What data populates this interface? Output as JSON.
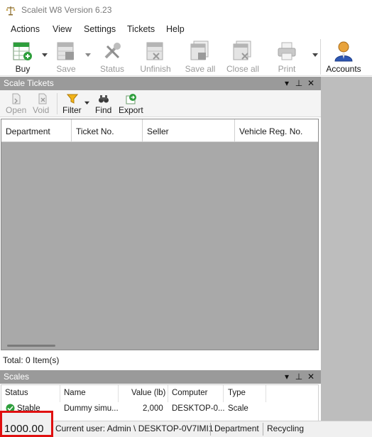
{
  "window": {
    "title": "Scaleit W8 Version 6.23"
  },
  "menu": [
    "Actions",
    "View",
    "Settings",
    "Tickets",
    "Help"
  ],
  "toolbar": {
    "buy": "Buy",
    "save": "Save",
    "status": "Status",
    "unfinish": "Unfinish",
    "save_all": "Save all",
    "close_all": "Close all",
    "print": "Print",
    "accounts": "Accounts"
  },
  "tickets_panel": {
    "title": "Scale Tickets",
    "buttons": {
      "open": "Open",
      "void": "Void",
      "filter": "Filter",
      "find": "Find",
      "export": "Export"
    },
    "columns": [
      "Department",
      "Ticket No.",
      "Seller",
      "Vehicle Reg. No."
    ],
    "total": "Total: 0 Item(s)"
  },
  "scales_panel": {
    "title": "Scales",
    "columns": [
      "Status",
      "Name",
      "Value (lb)",
      "Computer",
      "Type"
    ],
    "row": {
      "status": "Stable",
      "name": "Dummy simu...",
      "value": "2,000",
      "computer": "DESKTOP-0...",
      "type": "Scale"
    }
  },
  "statusbar": {
    "weight": "1000.00",
    "user": "Current user: Admin \\ DESKTOP-0V7IMI1",
    "department_label": "Department",
    "department_value": "Recycling"
  },
  "colors": {
    "panel_header": "#9a9a9a",
    "grid_bg": "#a9a9a9",
    "highlight_border": "#e01010",
    "buy_green": "#2e9e3c"
  }
}
